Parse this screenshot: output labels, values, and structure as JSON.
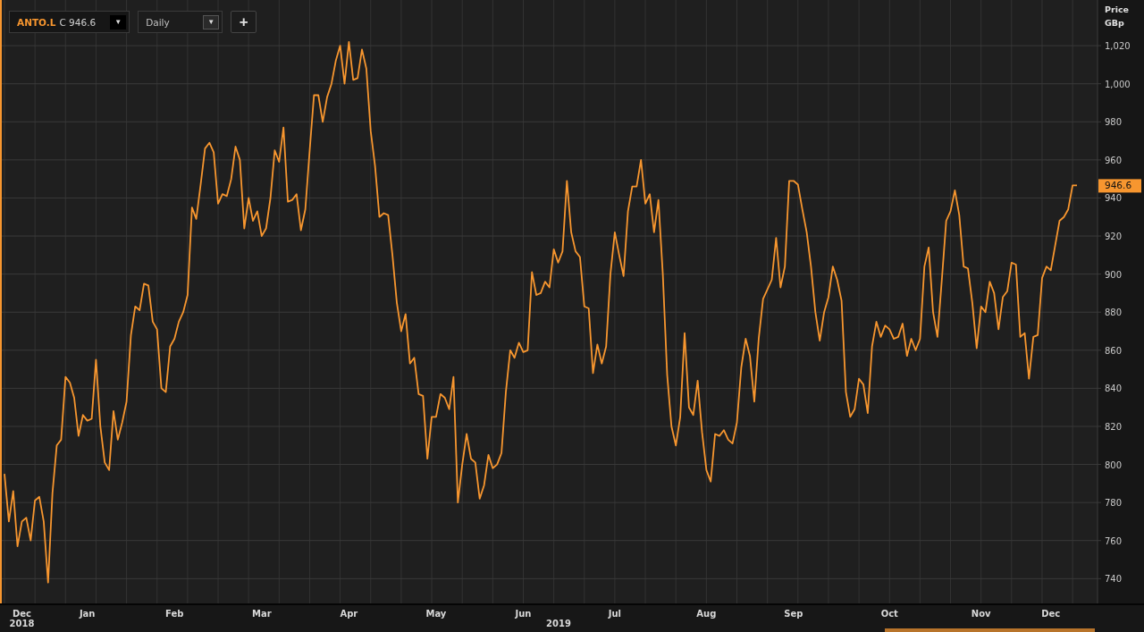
{
  "toolbar": {
    "quote": "C 946.6",
    "symbol_caret": "▼",
    "interval": "Daily",
    "interval_caret": "▼",
    "add_button": "+"
  },
  "chart": {
    "axis_title": "Price",
    "axis_unit": "GBp",
    "last_price": "946.6",
    "chart_data": {
      "type": "line",
      "ylim": [
        727,
        1044
      ],
      "grid": true,
      "categories": [
        null,
        null,
        null,
        null,
        "Dec",
        null,
        null,
        null,
        null,
        null,
        null,
        null,
        null,
        null,
        null,
        null,
        null,
        null,
        null,
        "Jan",
        null,
        null,
        null,
        null,
        null,
        null,
        null,
        null,
        null,
        null,
        null,
        null,
        null,
        null,
        null,
        null,
        null,
        null,
        null,
        "Feb",
        null,
        null,
        null,
        null,
        null,
        null,
        null,
        null,
        null,
        null,
        null,
        null,
        null,
        null,
        null,
        null,
        null,
        null,
        null,
        "Mar",
        null,
        null,
        null,
        null,
        null,
        null,
        null,
        null,
        null,
        null,
        null,
        null,
        null,
        null,
        null,
        null,
        null,
        null,
        null,
        "Apr",
        null,
        null,
        null,
        null,
        null,
        null,
        null,
        null,
        null,
        null,
        null,
        null,
        null,
        null,
        null,
        null,
        null,
        null,
        null,
        "May",
        null,
        null,
        null,
        null,
        null,
        null,
        null,
        null,
        null,
        null,
        null,
        null,
        null,
        null,
        null,
        null,
        null,
        null,
        null,
        "Jun",
        null,
        null,
        null,
        null,
        null,
        null,
        null,
        null,
        null,
        null,
        null,
        null,
        null,
        null,
        null,
        null,
        null,
        null,
        null,
        null,
        "Jul",
        null,
        null,
        null,
        null,
        null,
        null,
        null,
        null,
        null,
        null,
        null,
        null,
        null,
        null,
        null,
        null,
        null,
        null,
        null,
        null,
        "Aug",
        null,
        null,
        null,
        null,
        null,
        null,
        null,
        null,
        null,
        null,
        null,
        null,
        null,
        null,
        null,
        null,
        null,
        null,
        null,
        "Sep",
        null,
        null,
        null,
        null,
        null,
        null,
        null,
        null,
        null,
        null,
        null,
        null,
        null,
        null,
        null,
        null,
        null,
        null,
        null,
        null,
        null,
        "Oct",
        null,
        null,
        null,
        null,
        null,
        null,
        null,
        null,
        null,
        null,
        null,
        null,
        null,
        null,
        null,
        null,
        null,
        null,
        null,
        null,
        "Nov",
        null,
        null,
        null,
        null,
        null,
        null,
        null,
        null,
        null,
        null,
        null,
        null,
        null,
        null,
        null,
        "Dec",
        null,
        null,
        null,
        null,
        null,
        null
      ],
      "yticks": [
        {
          "value": 740,
          "label": "740"
        },
        {
          "value": 760,
          "label": "760"
        },
        {
          "value": 780,
          "label": "780"
        },
        {
          "value": 800,
          "label": "800"
        },
        {
          "value": 820,
          "label": "820"
        },
        {
          "value": 840,
          "label": "840"
        },
        {
          "value": 860,
          "label": "860"
        },
        {
          "value": 880,
          "label": "880"
        },
        {
          "value": 900,
          "label": "900"
        },
        {
          "value": 920,
          "label": "920"
        },
        {
          "value": 940,
          "label": "940"
        },
        {
          "value": 960,
          "label": "960"
        },
        {
          "value": 980,
          "label": "980"
        },
        {
          "value": 1000,
          "label": "1,000"
        },
        {
          "value": 1020,
          "label": "1,020"
        }
      ],
      "annotations": [
        "2018",
        "2019"
      ],
      "series": [
        {
          "name": "ANTO.L",
          "color": "#f7962f",
          "values": [
            795,
            770,
            786,
            757,
            770,
            772,
            760,
            781,
            783,
            770,
            738,
            785,
            810,
            813,
            846,
            843,
            835,
            815,
            826,
            823,
            824,
            855,
            820,
            801,
            797,
            828,
            813,
            822,
            833,
            868,
            883,
            881,
            895,
            894,
            875,
            871,
            840,
            838,
            862,
            866,
            875,
            880,
            889,
            935,
            929,
            947,
            966,
            969,
            964,
            937,
            942,
            941,
            950,
            967,
            960,
            924,
            940,
            928,
            933,
            920,
            924,
            940,
            965,
            959,
            977,
            938,
            939,
            942,
            923,
            934,
            965,
            994,
            994,
            980,
            993,
            1000,
            1012,
            1020,
            1000,
            1022,
            1002,
            1003,
            1018,
            1008,
            975,
            957,
            930,
            932,
            931,
            910,
            885,
            870,
            879,
            853,
            856,
            837,
            836,
            803,
            825,
            825,
            837,
            835,
            829,
            846,
            780,
            800,
            816,
            803,
            801,
            782,
            789,
            805,
            798,
            800,
            806,
            838,
            860,
            856,
            864,
            859,
            860,
            901,
            889,
            890,
            896,
            893,
            913,
            906,
            912,
            949,
            922,
            912,
            909,
            883,
            882,
            848,
            863,
            853,
            862,
            900,
            922,
            910,
            899,
            933,
            946,
            946,
            960,
            937,
            942,
            922,
            939,
            900,
            847,
            820,
            810,
            825,
            869,
            830,
            826,
            844,
            817,
            797,
            791,
            816,
            815,
            818,
            813,
            811,
            822,
            851,
            866,
            857,
            833,
            866,
            887,
            892,
            897,
            919,
            893,
            904,
            949,
            949,
            947,
            934,
            922,
            904,
            880,
            865,
            880,
            888,
            904,
            897,
            886,
            838,
            825,
            829,
            845,
            842,
            827,
            862,
            875,
            867,
            873,
            871,
            866,
            867,
            874,
            857,
            866,
            860,
            866,
            904,
            914,
            880,
            867,
            897,
            928,
            933,
            944,
            931,
            904,
            903,
            885,
            861,
            883,
            880,
            896,
            890,
            871,
            888,
            891,
            906,
            905,
            867,
            869,
            845,
            867,
            868,
            898,
            904,
            902,
            915,
            928,
            930,
            934,
            946.6,
            946.6
          ]
        }
      ]
    }
  }
}
